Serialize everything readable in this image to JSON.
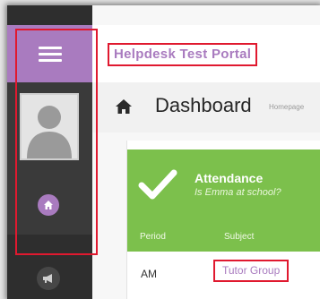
{
  "header": {
    "portal_title": "Helpdesk Test Portal"
  },
  "page": {
    "title": "Dashboard",
    "breadcrumb": "Homepage"
  },
  "sidebar": {
    "menu_icon": "hamburger-menu-icon",
    "avatar_icon": "user-avatar-icon",
    "home_icon": "home-icon",
    "announce_icon": "megaphone-icon"
  },
  "attendance": {
    "title": "Attendance",
    "subtitle": "Is Emma at school?",
    "columns": [
      "Period",
      "Subject"
    ],
    "rows": [
      {
        "period": "AM",
        "subject": "Tutor Group"
      }
    ]
  },
  "colors": {
    "accent_purple": "#a97bbf",
    "success_green": "#7cc04c",
    "highlight_red": "#e0192f",
    "sidebar_dark": "#2e2e2e"
  }
}
